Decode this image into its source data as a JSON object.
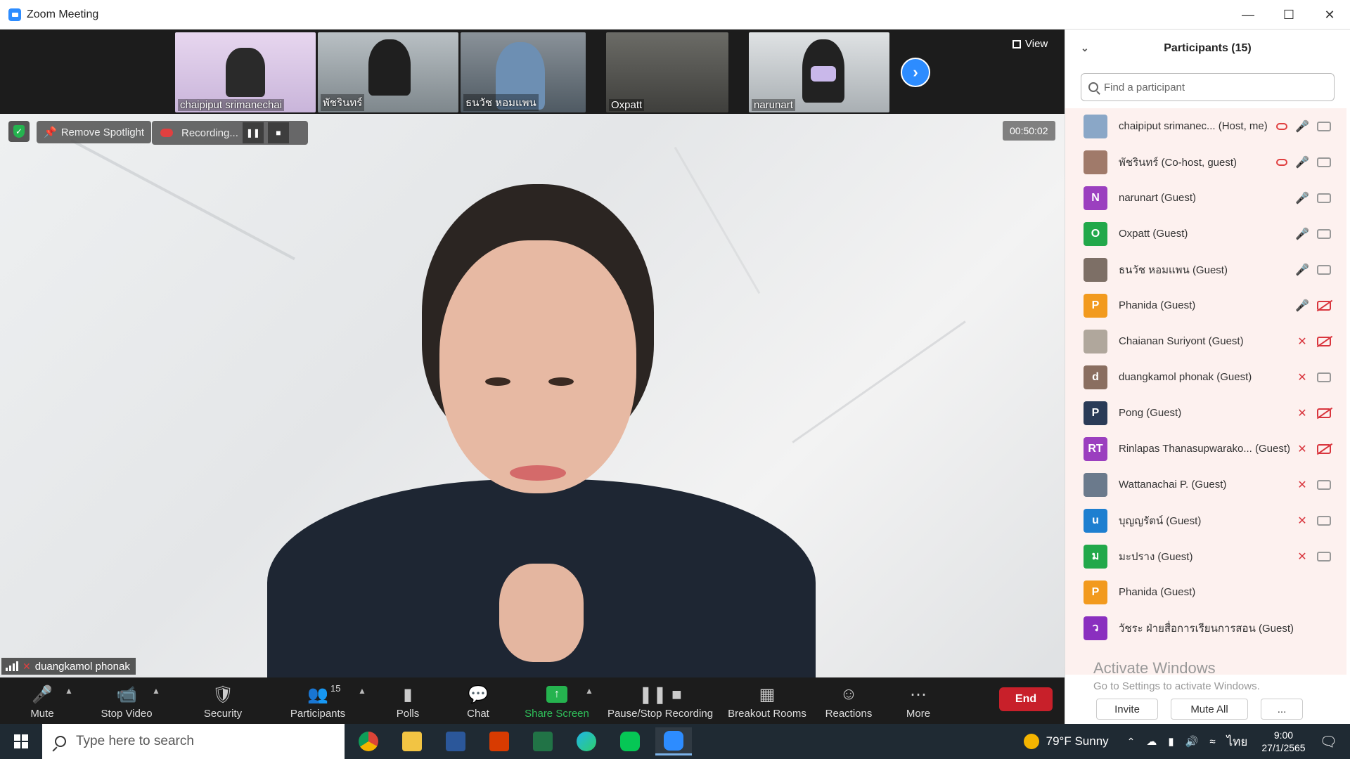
{
  "window": {
    "title": "Zoom Meeting",
    "icon": "zoom-camera-icon"
  },
  "thumbnails": [
    {
      "name": "chaipiput srimanechai",
      "color": "#d9c8e6"
    },
    {
      "name": "พัชรินทร์",
      "color": "#9aa3a8"
    },
    {
      "name": "ธนวัช หอมแพน",
      "color": "#6f7b84"
    },
    {
      "name": "Oxpatt",
      "color": "#5a5a55"
    },
    {
      "name": "narunart",
      "color": "#cfd3d6"
    }
  ],
  "view_label": "View",
  "main_video": {
    "remove_spotlight": "Remove Spotlight",
    "recording_label": "Recording...",
    "timer": "00:50:02",
    "speaker_name": "duangkamol phonak"
  },
  "toolbar": {
    "mute": "Mute",
    "stop_video": "Stop Video",
    "security": "Security",
    "participants": "Participants",
    "participants_count": "15",
    "polls": "Polls",
    "chat": "Chat",
    "share_screen": "Share Screen",
    "pause_stop_recording": "Pause/Stop Recording",
    "breakout_rooms": "Breakout Rooms",
    "reactions": "Reactions",
    "more": "More",
    "end": "End"
  },
  "panel": {
    "title": "Participants (15)",
    "search_placeholder": "Find a participant",
    "participants": [
      {
        "name": "chaipiput srimanec... (Host, me)",
        "initials": "",
        "avatar_color": "#8aa7c7",
        "recording": true,
        "mic_muted": false,
        "cam_off": false
      },
      {
        "name": "พัชรินทร์ (Co-host, guest)",
        "initials": "",
        "avatar_color": "#a07a6a",
        "recording": true,
        "mic_muted": false,
        "cam_off": false
      },
      {
        "name": "narunart (Guest)",
        "initials": "N",
        "avatar_color": "#9b3fbf",
        "recording": false,
        "mic_muted": false,
        "cam_off": false
      },
      {
        "name": "Oxpatt (Guest)",
        "initials": "O",
        "avatar_color": "#22a84a",
        "recording": false,
        "mic_muted": false,
        "cam_off": false
      },
      {
        "name": "ธนวัช หอมแพน (Guest)",
        "initials": "",
        "avatar_color": "#7d6f66",
        "recording": false,
        "mic_muted": false,
        "cam_off": false
      },
      {
        "name": "Phanida (Guest)",
        "initials": "P",
        "avatar_color": "#f29a1e",
        "recording": false,
        "mic_muted": false,
        "cam_off": true
      },
      {
        "name": "Chaianan Suriyont (Guest)",
        "initials": "",
        "avatar_color": "#b0a79c",
        "recording": false,
        "mic_muted": true,
        "cam_off": true
      },
      {
        "name": "duangkamol phonak (Guest)",
        "initials": "d",
        "avatar_color": "#8a6e60",
        "recording": false,
        "mic_muted": true,
        "cam_off": false
      },
      {
        "name": "Pong (Guest)",
        "initials": "P",
        "avatar_color": "#2a3b57",
        "recording": false,
        "mic_muted": true,
        "cam_off": true
      },
      {
        "name": "Rinlapas Thanasupwarako... (Guest)",
        "initials": "RT",
        "avatar_color": "#9b3fbf",
        "recording": false,
        "mic_muted": true,
        "cam_off": true
      },
      {
        "name": "Wattanachai P. (Guest)",
        "initials": "",
        "avatar_color": "#6b7a8c",
        "recording": false,
        "mic_muted": true,
        "cam_off": false
      },
      {
        "name": "บุญญรัตน์ (Guest)",
        "initials": "u",
        "avatar_color": "#1e7fd0",
        "recording": false,
        "mic_muted": true,
        "cam_off": false
      },
      {
        "name": "มะปราง (Guest)",
        "initials": "ม",
        "avatar_color": "#22a84a",
        "recording": false,
        "mic_muted": true,
        "cam_off": false
      },
      {
        "name": "Phanida (Guest)",
        "initials": "P",
        "avatar_color": "#f29a1e",
        "recording": false,
        "mic_muted": null,
        "cam_off": null
      },
      {
        "name": "วัชระ ฝ่ายสื่อการเรียนการสอน (Guest)",
        "initials": "ว",
        "avatar_color": "#8a2fbf",
        "recording": false,
        "mic_muted": null,
        "cam_off": null
      }
    ],
    "activate_title": "Activate Windows",
    "activate_sub": "Go to Settings to activate Windows.",
    "invite": "Invite",
    "mute_all": "Mute All",
    "more": "..."
  },
  "taskbar": {
    "search_placeholder": "Type here to search",
    "weather": "79°F  Sunny",
    "lang": "ไทย",
    "time": "9:00",
    "date": "27/1/2565"
  }
}
